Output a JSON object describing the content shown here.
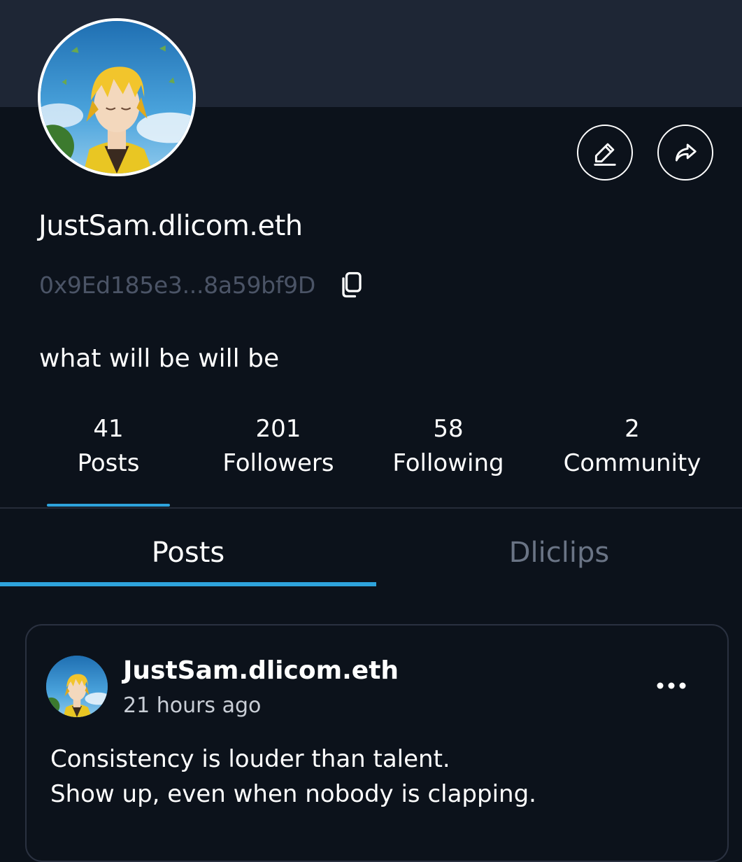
{
  "profile": {
    "display_name": "JustSam.dlicom.eth",
    "address": "0x9Ed185e3...8a59bf9D",
    "bio": "what will be will be",
    "avatar_icon": "anime-character-avatar",
    "edit_icon": "pencil-icon",
    "share_icon": "share-arrow-icon",
    "copy_icon": "copy-icon"
  },
  "stats": [
    {
      "value": "41",
      "label": "Posts"
    },
    {
      "value": "201",
      "label": "Followers"
    },
    {
      "value": "58",
      "label": "Following"
    },
    {
      "value": "2",
      "label": "Community"
    }
  ],
  "tabs": [
    {
      "label": "Posts",
      "active": true
    },
    {
      "label": "Dliclips",
      "active": false
    }
  ],
  "post": {
    "author": "JustSam.dlicom.eth",
    "time": "21 hours ago",
    "lines": [
      "Consistency is louder than talent.",
      "Show up, even when nobody is clapping."
    ],
    "more_icon": "more-horizontal-icon"
  },
  "colors": {
    "background": "#0c121b",
    "banner": "#1e2635",
    "accent": "#2ea3dc",
    "muted_text": "#4b5466",
    "inactive_tab": "#6a7485"
  }
}
